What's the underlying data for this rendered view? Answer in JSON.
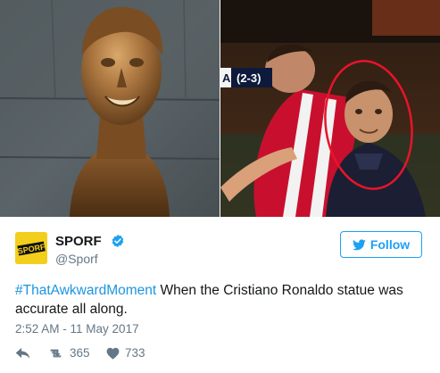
{
  "tweet": {
    "user": {
      "avatar_text": "SPORF",
      "display_name": "SPORF",
      "handle": "@Sporf",
      "verified": true
    },
    "follow_label": "Follow",
    "hashtag": "#ThatAwkwardMoment",
    "body": " When the Cristiano Ronaldo statue was accurate all along.",
    "timestamp": "2:52 AM - 11 May 2017",
    "retweet_count": "365",
    "like_count": "733"
  },
  "media": {
    "score_overlay": "(2-3)",
    "overlay_left_mark": "A"
  },
  "colors": {
    "accent": "#1da1f2",
    "hashtag": "#1b95e0",
    "secondary_text": "#657786",
    "avatar_bg": "#f2cf1d",
    "highlight_circle": "#e8142a"
  }
}
